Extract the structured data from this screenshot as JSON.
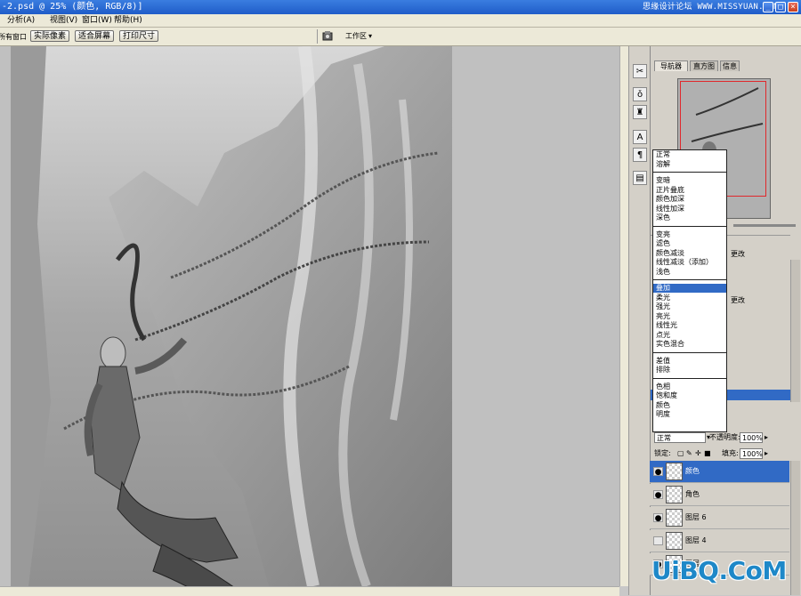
{
  "window": {
    "title": "-2.psd @ 25% (颜色, RGB/8)]",
    "watermark": "思缘设计论坛 WWW.MISSYUAN.COM",
    "min_label": "_",
    "max_label": "□",
    "close_label": "×"
  },
  "menu": {
    "items": [
      "分析(A)",
      "视图(V)",
      "窗口(W)",
      "帮助(H)"
    ]
  },
  "options": {
    "all_windows_label": "所有窗口",
    "actual_pixels": "实际像素",
    "fit_screen": "适合屏幕",
    "print_size": "打印尺寸",
    "workspace": "工作区"
  },
  "navigator": {
    "tabs": [
      "导航器",
      "直方图",
      "信息"
    ]
  },
  "history_partial": {
    "lines": [
      "更改",
      "更改"
    ]
  },
  "blend_modes": {
    "groups": [
      [
        "正常",
        "溶解"
      ],
      [
        "变暗",
        "正片叠底",
        "颜色加深",
        "线性加深",
        "深色"
      ],
      [
        "变亮",
        "滤色",
        "颜色减淡",
        "线性减淡（添加）",
        "浅色"
      ],
      [
        "叠加",
        "柔光",
        "强光",
        "亮光",
        "线性光",
        "点光",
        "实色混合"
      ],
      [
        "差值",
        "排除"
      ],
      [
        "色相",
        "饱和度",
        "颜色",
        "明度"
      ]
    ],
    "selected": "叠加"
  },
  "layers": {
    "blend_value": "正常",
    "opacity_label": "不透明度:",
    "opacity_value": "100%",
    "lock_label": "锁定:",
    "fill_label": "填充:",
    "fill_value": "100%",
    "items": [
      {
        "name": "颜色",
        "selected": true,
        "visible": true
      },
      {
        "name": "角色",
        "selected": false,
        "visible": true
      },
      {
        "name": "图层 6",
        "selected": false,
        "visible": true
      },
      {
        "name": "图层 4",
        "selected": false,
        "visible": false
      },
      {
        "name": "图层",
        "selected": false,
        "visible": true
      }
    ]
  },
  "logo": {
    "text": "UiBQ.CoM"
  },
  "colors": {
    "titlebar": "#1f5cc8",
    "selection": "#316ac5",
    "nav_frame": "#e0282c",
    "logo": "#1e88c8"
  }
}
